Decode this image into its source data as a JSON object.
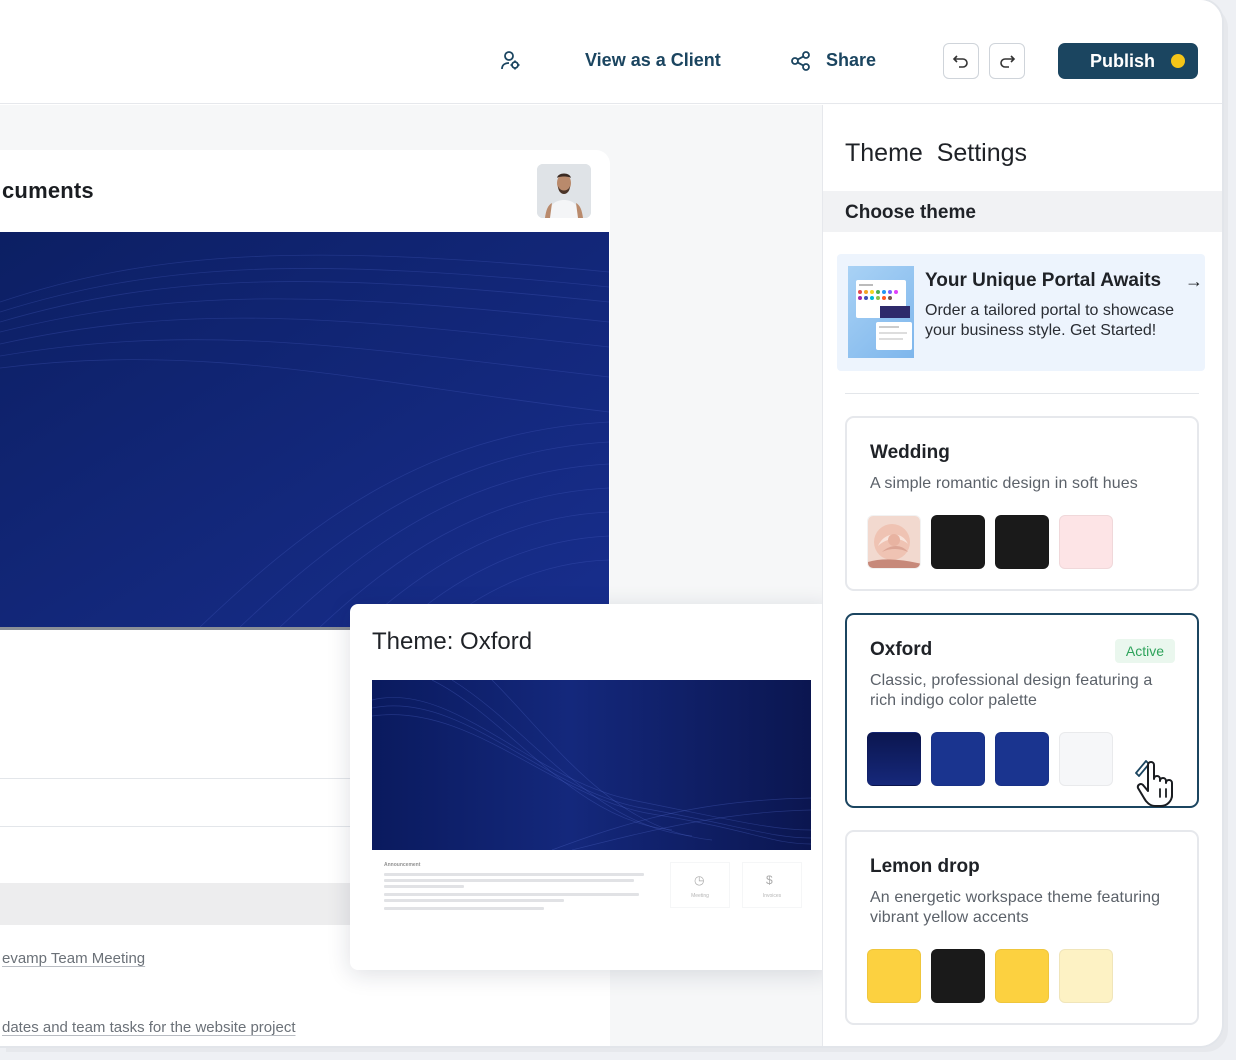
{
  "topbar": {
    "view_as_client": "View as a Client",
    "share": "Share",
    "publish": "Publish",
    "publish_dot_color": "#f5c518",
    "icons": [
      "user-settings-icon",
      "share-icon",
      "undo-icon",
      "redo-icon"
    ]
  },
  "canvas": {
    "doc_title": "cuments",
    "links": [
      "evamp Team Meeting",
      "dates and team tasks for the website project"
    ],
    "hero_color": "#172c8a"
  },
  "preview": {
    "title": "Theme: Oxford",
    "mini": {
      "announcement": "Announcement",
      "tiles": [
        {
          "glyph": "◷",
          "label": "Meeting"
        },
        {
          "glyph": "$",
          "label": "Invoices"
        }
      ]
    }
  },
  "panel": {
    "title": "Theme  Settings",
    "section": "Choose theme",
    "promo": {
      "heading": "Your Unique Portal Awaits",
      "arrow": "→",
      "body": "Order a tailored portal to showcase your business style. Get Started!"
    },
    "themes": [
      {
        "name": "Wedding",
        "description": "A simple romantic design in soft hues",
        "active": false,
        "swatches": [
          "image-rose",
          "#1a1a1a",
          "#1a1a1a",
          "#fde4e6"
        ]
      },
      {
        "name": "Oxford",
        "description": "Classic, professional design featuring a rich indigo color palette",
        "active": true,
        "badge": "Active",
        "swatches": [
          "#0b1650",
          "#1a348f",
          "#1a348f",
          "#f6f7f9"
        ]
      },
      {
        "name": "Lemon drop",
        "description": "An energetic workspace theme featuring vibrant yellow accents",
        "active": false,
        "swatches": [
          "#fcd140",
          "#1a1a1a",
          "#fcd140",
          "#fdf2c4"
        ]
      }
    ]
  }
}
